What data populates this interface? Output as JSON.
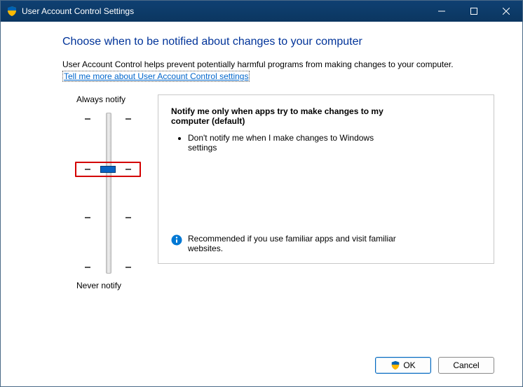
{
  "window": {
    "title": "User Account Control Settings"
  },
  "heading": "Choose when to be notified about changes to your computer",
  "subtext": "User Account Control helps prevent potentially harmful programs from making changes to your computer.",
  "help_link": "Tell me more about User Account Control settings",
  "slider": {
    "top_label": "Always notify",
    "bottom_label": "Never notify",
    "levels": 4,
    "current_level": 1
  },
  "description": {
    "title": "Notify me only when apps try to make changes to my computer (default)",
    "bullets": [
      "Don't notify me when I make changes to Windows settings"
    ],
    "recommendation": "Recommended if you use familiar apps and visit familiar websites."
  },
  "buttons": {
    "ok": "OK",
    "cancel": "Cancel"
  }
}
